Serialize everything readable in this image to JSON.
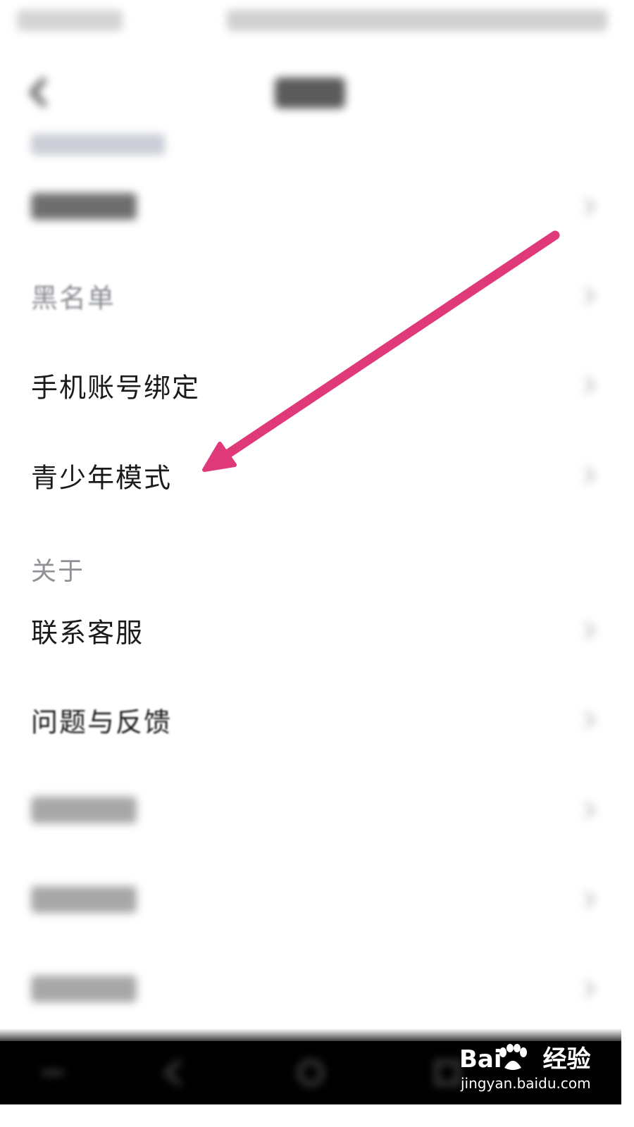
{
  "rows": [
    {
      "label": "黑名单"
    },
    {
      "label": "手机账号绑定"
    },
    {
      "label": "青少年模式"
    },
    {
      "label": "联系客服"
    },
    {
      "label": "问题与反馈"
    }
  ],
  "section_about": "关于",
  "watermark": {
    "brand_left": "Bai",
    "brand_right": "经验",
    "url": "jingyan.baidu.com"
  },
  "colors": {
    "arrow": "#e0397a",
    "nav_bar": "#000000",
    "section_label": "#8e9196"
  },
  "icons": [
    "back-arrow-icon",
    "chevron-right-icon",
    "annotation-arrow",
    "baidu-paw-logo"
  ]
}
